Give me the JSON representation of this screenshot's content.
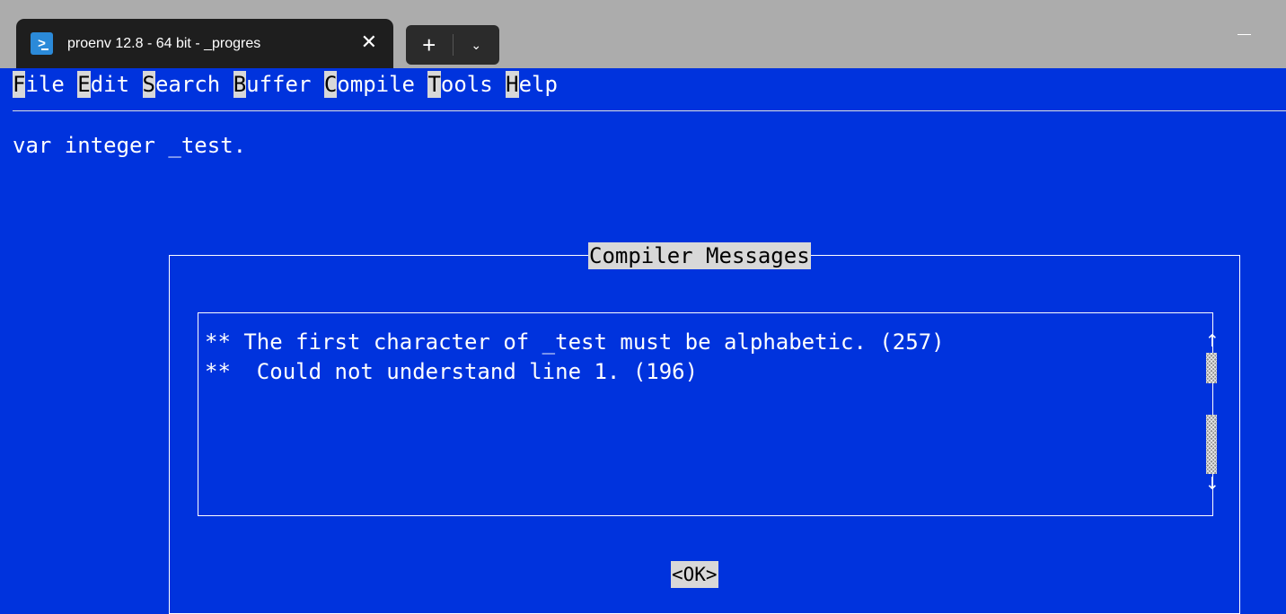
{
  "window": {
    "tab_title": "proenv 12.8 - 64 bit - _progres",
    "tab_icon": "powershell-icon",
    "tab_close": "✕",
    "new_tab": "+",
    "tab_dropdown": "⌄",
    "minimize_icon": "minimize-icon"
  },
  "menu": [
    {
      "hotkey": "F",
      "rest": "ile"
    },
    {
      "hotkey": "E",
      "rest": "dit"
    },
    {
      "hotkey": "S",
      "rest": "earch"
    },
    {
      "hotkey": "B",
      "rest": "uffer"
    },
    {
      "hotkey": "C",
      "rest": "ompile"
    },
    {
      "hotkey": "T",
      "rest": "ools"
    },
    {
      "hotkey": "H",
      "rest": "elp"
    }
  ],
  "editor": {
    "line1": "var integer _test."
  },
  "dialog": {
    "title": "Compiler Messages",
    "messages": [
      "** The first character of _test must be alphabetic. (257)",
      "**  Could not understand line 1. (196)"
    ],
    "scroll_up": "↑",
    "scroll_down": "↓",
    "ok_label": "<OK>"
  },
  "colors": {
    "background": "#0033dd",
    "text": "#ffffff",
    "highlight": "#d8d8d8",
    "titlebar": "#acacac",
    "tab": "#1e1e1e"
  }
}
